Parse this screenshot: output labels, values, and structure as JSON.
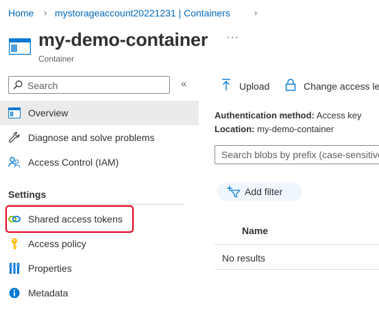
{
  "breadcrumb": {
    "items": [
      "Home",
      "mystorageaccount20221231 | Containers"
    ],
    "separator": "›"
  },
  "header": {
    "title": "my-demo-container",
    "subtitle": "Container",
    "more": "···",
    "icon": "container-icon"
  },
  "sidebar": {
    "search_placeholder": "Search",
    "collapse": "«",
    "items": [
      {
        "label": "Overview",
        "icon": "overview-icon",
        "active": true
      },
      {
        "label": "Diagnose and solve problems",
        "icon": "wrench-icon"
      },
      {
        "label": "Access Control (IAM)",
        "icon": "people-icon"
      }
    ],
    "settings_heading": "Settings",
    "settings_items": [
      {
        "label": "Shared access tokens",
        "icon": "link-icon",
        "highlighted": true
      },
      {
        "label": "Access policy",
        "icon": "key-icon"
      },
      {
        "label": "Properties",
        "icon": "properties-icon"
      },
      {
        "label": "Metadata",
        "icon": "info-icon"
      }
    ]
  },
  "toolbar": {
    "upload_label": "Upload",
    "change_access_label": "Change access le"
  },
  "properties": {
    "auth_label": "Authentication method:",
    "auth_value": "Access key",
    "location_label": "Location:",
    "location_value": "my-demo-container"
  },
  "blob_search": {
    "placeholder": "Search blobs by prefix (case-sensitive)"
  },
  "filter": {
    "label": "Add filter"
  },
  "table": {
    "columns": [
      "Name"
    ],
    "empty_text": "No results"
  },
  "colors": {
    "link": "#0067b8",
    "highlight_border": "#e3001b",
    "active_nav": "#edebe9",
    "pill": "#eff6fc"
  }
}
